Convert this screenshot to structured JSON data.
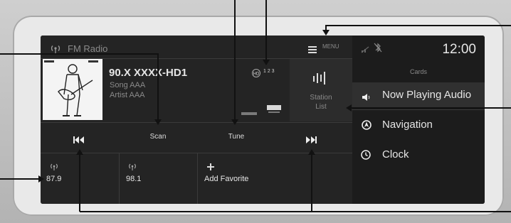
{
  "header": {
    "source_title": "FM Radio",
    "menu_label": "MENU",
    "clock": "12:00"
  },
  "now_playing": {
    "station": "90.X XXXX-HD1",
    "song": "Song AAA",
    "artist": "Artist AAA",
    "hd_channels": "1 2 3"
  },
  "buttons": {
    "scan": "Scan",
    "tune": "Tune",
    "station_list": "Station\nList"
  },
  "presets": [
    {
      "freq": "87.9"
    },
    {
      "freq": "98.1"
    },
    {
      "label": "Add Favorite"
    }
  ],
  "cards": {
    "title": "Cards",
    "items": [
      {
        "label": "Now Playing Audio"
      },
      {
        "label": "Navigation"
      },
      {
        "label": "Clock"
      }
    ]
  }
}
